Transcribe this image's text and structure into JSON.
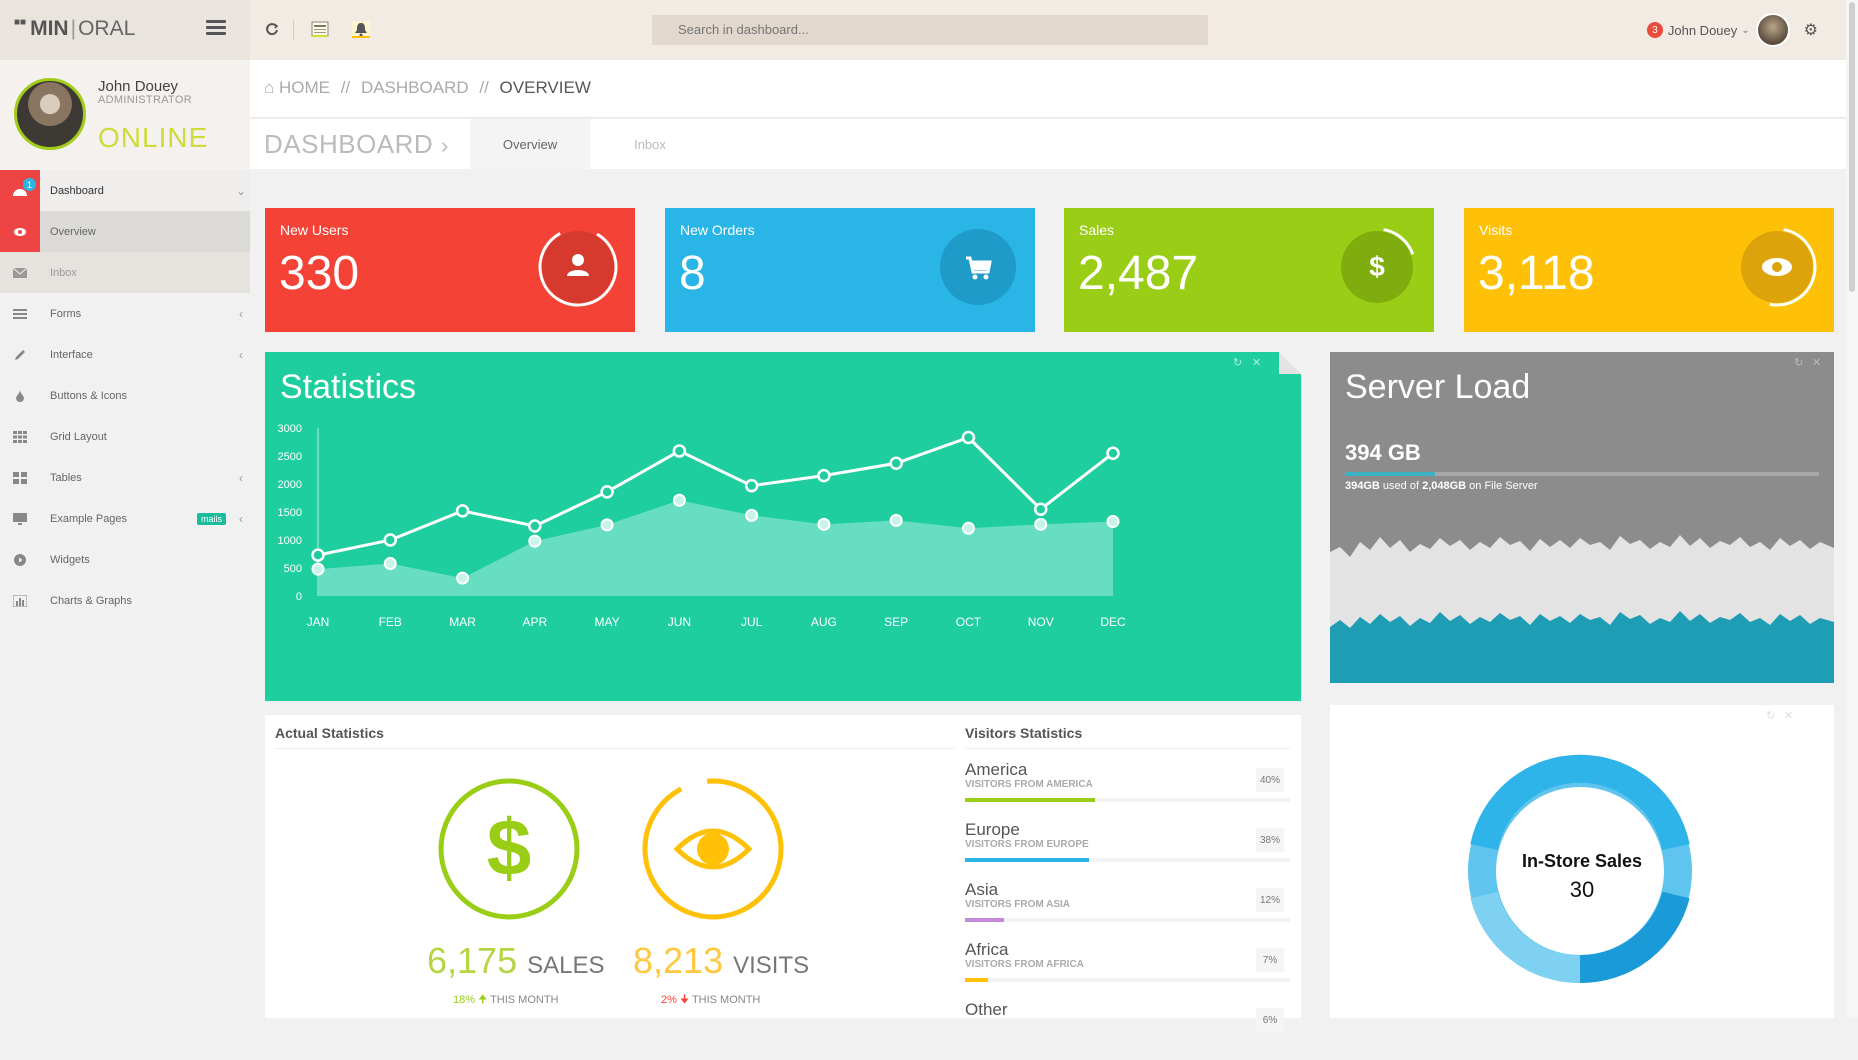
{
  "header": {
    "logo_bold": "MIN",
    "logo_light": "ORAL",
    "search_placeholder": "Search in dashboard...",
    "notification_count": "3",
    "user_name": "John Douey"
  },
  "profile": {
    "name": "John Douey",
    "role": "ADMINISTRATOR",
    "status": "ONLINE"
  },
  "sidebar": {
    "dashboard_badge": "1",
    "items": [
      {
        "label": "Dashboard"
      },
      {
        "label": "Overview"
      },
      {
        "label": "Inbox"
      },
      {
        "label": "Forms"
      },
      {
        "label": "Interface"
      },
      {
        "label": "Buttons & Icons"
      },
      {
        "label": "Grid Layout"
      },
      {
        "label": "Tables"
      },
      {
        "label": "Example Pages",
        "badge": "mails"
      },
      {
        "label": "Widgets"
      },
      {
        "label": "Charts & Graphs"
      }
    ]
  },
  "breadcrumb": {
    "home": "HOME",
    "sep1": "//",
    "dashboard": "DASHBOARD",
    "sep2": "//",
    "current": "OVERVIEW"
  },
  "page": {
    "title": "DASHBOARD",
    "tabs": [
      "Overview",
      "Inbox"
    ]
  },
  "tiles": [
    {
      "label": "New Users",
      "value": "330",
      "color": "#f44336",
      "icon": "user-icon"
    },
    {
      "label": "New Orders",
      "value": "8",
      "color": "#29b6e6",
      "icon": "cart-icon"
    },
    {
      "label": "Sales",
      "value": "2,487",
      "color": "#9acd15",
      "icon": "dollar-icon"
    },
    {
      "label": "Visits",
      "value": "3,118",
      "color": "#ffc107",
      "icon": "eye-icon"
    }
  ],
  "chart_data": {
    "type": "line",
    "title": "Statistics",
    "categories": [
      "JAN",
      "FEB",
      "MAR",
      "APR",
      "MAY",
      "JUN",
      "JUL",
      "AUG",
      "SEP",
      "OCT",
      "NOV",
      "DEC"
    ],
    "series": [
      {
        "values": [
          730,
          1000,
          1520,
          1250,
          1860,
          2590,
          1970,
          2150,
          2370,
          2830,
          1550,
          2550
        ]
      },
      {
        "values": [
          480,
          580,
          320,
          980,
          1270,
          1710,
          1440,
          1280,
          1350,
          1210,
          1280,
          1330
        ]
      }
    ],
    "ylim": [
      0,
      3000
    ],
    "yticks": [
      0,
      500,
      1000,
      1500,
      2000,
      2500,
      3000
    ],
    "grid": false,
    "colors": {
      "line1": "#ffffff",
      "area2": "#6fe0c4"
    }
  },
  "server": {
    "title": "Server Load",
    "value": "394 GB",
    "used_fraction": 0.19,
    "used": "394GB",
    "used_text": "used of",
    "total": "2,048GB",
    "location": "on File Server"
  },
  "actual": {
    "title": "Actual Statistics",
    "sales_value": "6,175",
    "sales_unit": "SALES",
    "sales_change": "18%",
    "sales_period": "THIS MONTH",
    "visits_value": "8,213",
    "visits_unit": "VISITS",
    "visits_change": "2%",
    "visits_period": "THIS MONTH"
  },
  "visitors": {
    "title": "Visitors Statistics",
    "rows": [
      {
        "name": "America",
        "sub": "VISITORS FROM AMERICA",
        "pct": "40%",
        "fraction": 0.4,
        "color": "#9acd15"
      },
      {
        "name": "Europe",
        "sub": "VISITORS FROM EUROPE",
        "pct": "38%",
        "fraction": 0.38,
        "color": "#29b6e6"
      },
      {
        "name": "Asia",
        "sub": "VISITORS FROM ASIA",
        "pct": "12%",
        "fraction": 0.12,
        "color": "#c58bd8"
      },
      {
        "name": "Africa",
        "sub": "VISITORS FROM AFRICA",
        "pct": "7%",
        "fraction": 0.07,
        "color": "#ffc107"
      },
      {
        "name": "Other",
        "sub": "",
        "pct": "6%",
        "fraction": 0.06,
        "color": "#cccccc"
      }
    ]
  },
  "instore": {
    "label": "In-Store Sales",
    "value": "30"
  }
}
